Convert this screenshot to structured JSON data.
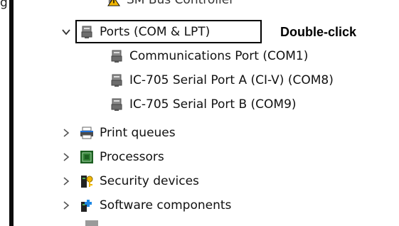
{
  "partial_top_item": {
    "label": "SM Bus Controller",
    "icon": "warning-device-icon"
  },
  "left_fragment": "g",
  "tree": {
    "ports": {
      "label": "Ports (COM & LPT)",
      "expanded": true,
      "icon": "port-connector-icon",
      "children": [
        {
          "label": "Communications Port (COM1)",
          "icon": "port-connector-icon"
        },
        {
          "label": "IC-705 Serial Port A (CI-V) (COM8)",
          "icon": "port-connector-icon"
        },
        {
          "label": "IC-705 Serial Port B (COM9)",
          "icon": "port-connector-icon"
        }
      ]
    },
    "collapsed": [
      {
        "label": "Print queues",
        "icon": "printer-icon"
      },
      {
        "label": "Processors",
        "icon": "processor-icon"
      },
      {
        "label": "Security devices",
        "icon": "security-device-icon"
      },
      {
        "label": "Software components",
        "icon": "software-component-icon"
      }
    ]
  },
  "annotation": {
    "text": "Double-click"
  },
  "colors": {
    "highlight_border": "#000000",
    "processor_green": "#2e7d32",
    "security_yellow": "#f2b705",
    "software_blue": "#1e88e5"
  }
}
